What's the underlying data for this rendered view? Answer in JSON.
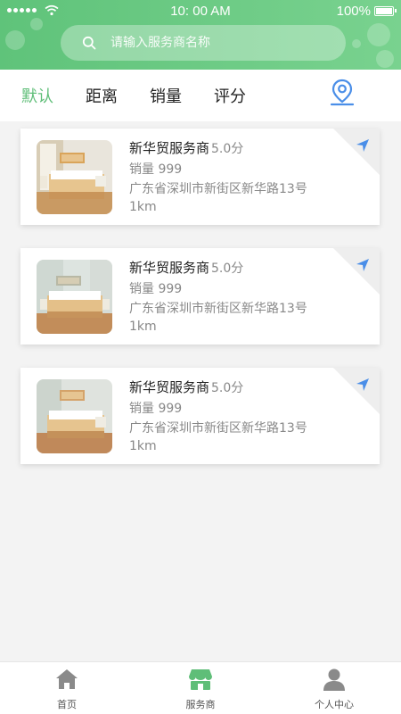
{
  "status": {
    "time": "10:  00 AM",
    "battery": "100%"
  },
  "search": {
    "placeholder": "请输入服务商名称"
  },
  "filters": [
    {
      "label": "默认",
      "active": true
    },
    {
      "label": "距离"
    },
    {
      "label": "销量"
    },
    {
      "label": "评分"
    }
  ],
  "providers": [
    {
      "name": "新华贸服务商",
      "score": "5.0分",
      "sales": "销量 999",
      "address": "广东省深圳市新街区新华路13号",
      "distance": "1km"
    },
    {
      "name": "新华贸服务商",
      "score": "5.0分",
      "sales": "销量 999",
      "address": "广东省深圳市新街区新华路13号",
      "distance": "1km"
    },
    {
      "name": "新华贸服务商",
      "score": "5.0分",
      "sales": "销量 999",
      "address": "广东省深圳市新街区新华路13号",
      "distance": "1km"
    }
  ],
  "tabbar": [
    {
      "label": "首页",
      "icon": "home-icon"
    },
    {
      "label": "服务商",
      "icon": "shop-icon",
      "active": true
    },
    {
      "label": "个人中心",
      "icon": "user-icon"
    }
  ],
  "colors": {
    "primary": "#5fbe78",
    "location_icon": "#4a8ee8",
    "inactive_icon": "#8a8a8a"
  }
}
